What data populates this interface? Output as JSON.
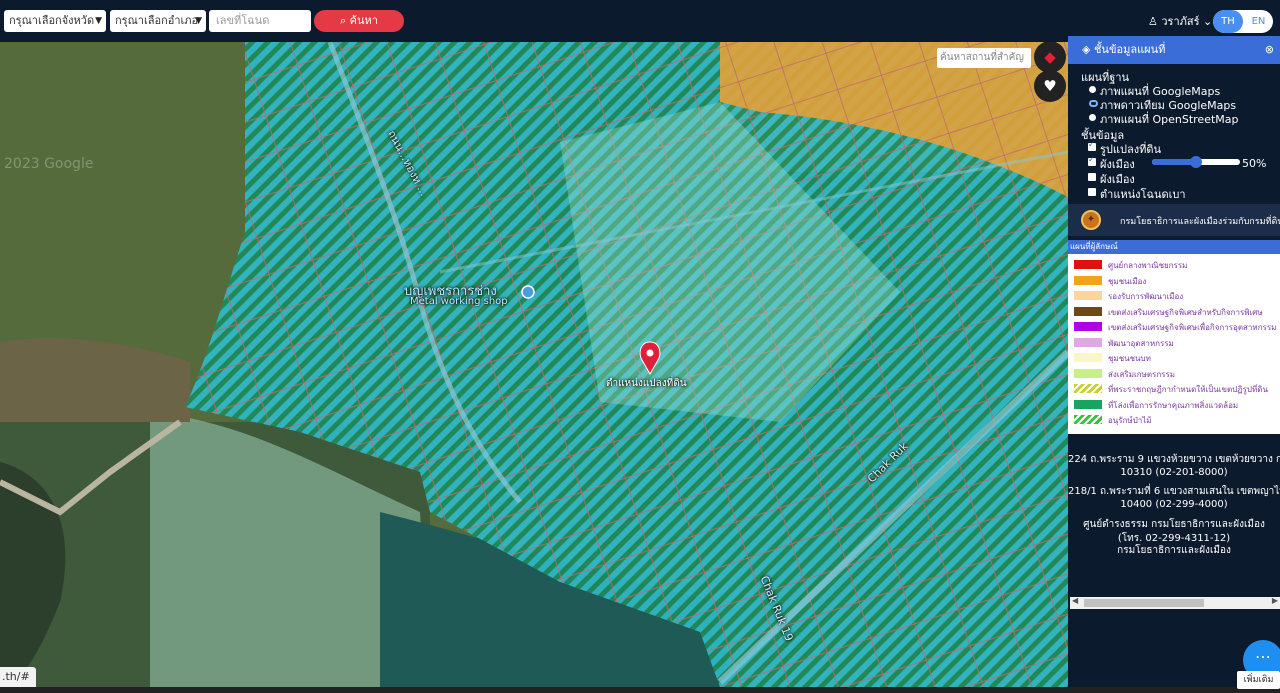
{
  "topbar": {
    "province_select": "กรุณาเลือกจังหวัด",
    "amphoe_select": "กรุณาเลือกอำเภอ",
    "deed_placeholder": "เลขที่โฉนด",
    "search_label": "ค้นหา",
    "user_name": "วราภัสร์",
    "lang_th": "TH",
    "lang_en": "EN"
  },
  "map": {
    "place_search_placeholder": "ค้นหาสถานที่สำคัญ",
    "watermark": "2023 Google",
    "poi_name_th": "บญเพชรการช่าง",
    "poi_name_en": "Metal working shop",
    "marker_label": "ตำแหน่งแปลงที่ดิน",
    "road_labels": [
      "ถนน...หองห ...",
      "Chak Ruk",
      "Chak Ruk 19"
    ],
    "status_url": ".th/#",
    "colors": {
      "zone_fill": "#2fd3e0",
      "zone_hatch": "#1f8a5a",
      "marker": "#e0203a"
    }
  },
  "panel": {
    "title": "ชั้นข้อมูลแผนที่",
    "basemap_heading": "แผนที่ฐาน",
    "basemaps": [
      {
        "label": "ภาพแผนที่ GoogleMaps",
        "selected": false
      },
      {
        "label": "ภาพดาวเทียม GoogleMaps",
        "selected": true
      },
      {
        "label": "ภาพแผนที่ OpenStreetMap",
        "selected": false
      }
    ],
    "layers_heading": "ชั้นข้อมูล",
    "layers": [
      {
        "label": "รูปแปลงที่ดิน",
        "checked": true
      },
      {
        "label": "ผังเมือง",
        "checked": true
      },
      {
        "label": "ผังเมือง",
        "checked": false
      },
      {
        "label": "ตำแหน่งโฉนดเบา",
        "checked": false
      }
    ],
    "opacity_value": "50%",
    "opacity_percent": 50,
    "dept_name": "กรมโยธาธิการและผังเมืองร่วมกับกรมที่ดิน",
    "legend_heading": "แผนที่ผู้ลักษณ์",
    "legend": [
      {
        "label": "ศูนย์กลางพาณิชยกรรม",
        "color": "#e01010",
        "pattern": "solid"
      },
      {
        "label": "ชุมชนเมือง",
        "color": "#f3a21c",
        "pattern": "solid"
      },
      {
        "label": "รองรับการพัฒนาเมือง",
        "color": "#f7d79a",
        "pattern": "solid"
      },
      {
        "label": "เขตส่งเสริมเศรษฐกิจพิเศษสำหรับกิจการพิเศษ",
        "color": "#6b4a13",
        "pattern": "solid"
      },
      {
        "label": "เขตส่งเสริมเศรษฐกิจพิเศษเพื่อกิจการอุตสาหกรรม",
        "color": "#b100e8",
        "pattern": "solid"
      },
      {
        "label": "พัฒนาอุตสาหกรรม",
        "color": "#e2a6e6",
        "pattern": "solid"
      },
      {
        "label": "ชุมชนชนบท",
        "color": "#fbf6c8",
        "pattern": "solid"
      },
      {
        "label": "ส่งเสริมเกษตรกรรม",
        "color": "#c8f08a",
        "pattern": "solid"
      },
      {
        "label": "ที่พระราชกฤษฎีกากำหนดให้เป็นเขตปฏิรูปที่ดิน",
        "color": "#c9cf2f",
        "pattern": "hatch"
      },
      {
        "label": "ที่โล่งเพื่อการรักษาคุณภาพสิ่งแวดล้อม",
        "color": "#16a561",
        "pattern": "solid"
      },
      {
        "label": "อนุรักษ์ป่าไม้",
        "color": "#38c23a",
        "pattern": "hatch"
      }
    ],
    "address_lines": [
      "224 ถ.พระราม 9 แขวงห้วยขวาง เขตห้วยขวาง กรุงเทพฯ",
      "10310 (02-201-8000)",
      "218/1 ถ.พระรามที่ 6 แขวงสามเสนใน เขตพญาไท กรุงเทพฯ",
      "10400 (02-299-4000)",
      "ศูนย์ดำรงธรรม กรมโยธาธิการและผังเมือง",
      "(โทร. 02-299-4311-12)",
      "กรมโยธาธิการและผังเมือง"
    ]
  },
  "more_label": "เพิ่มเติม"
}
